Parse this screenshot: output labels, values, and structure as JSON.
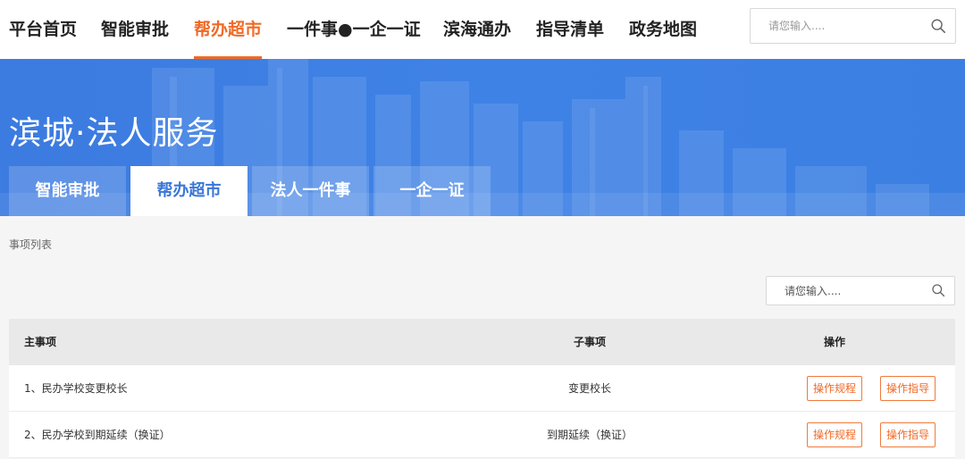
{
  "topnav": {
    "items": [
      {
        "label": "平台首页",
        "active": false
      },
      {
        "label": "智能审批",
        "active": false
      },
      {
        "label": "帮办超市",
        "active": true
      },
      {
        "label": "一件事●一企一证",
        "active": false
      },
      {
        "label": "滨海通办",
        "active": false
      },
      {
        "label": "指导清单",
        "active": false
      },
      {
        "label": "政务地图",
        "active": false
      }
    ],
    "search_placeholder": "请您输入....",
    "accent_color": "#f06a26"
  },
  "banner": {
    "title": "滨城·法人服务",
    "tabs": [
      {
        "label": "智能审批",
        "active": false
      },
      {
        "label": "帮办超市",
        "active": true
      },
      {
        "label": "法人一件事",
        "active": false
      },
      {
        "label": "一企一证",
        "active": false
      }
    ],
    "color": "#3f82e6"
  },
  "content": {
    "breadcrumb": "事项列表",
    "search_placeholder": "请您输入....",
    "table": {
      "headers": [
        "主事项",
        "子事项",
        "操作"
      ],
      "rows": [
        {
          "main": "1、民办学校变更校长",
          "sub": "变更校长",
          "actions": [
            "操作规程",
            "操作指导"
          ]
        },
        {
          "main": "2、民办学校到期延续（换证）",
          "sub": "到期延续（换证）",
          "actions": [
            "操作规程",
            "操作指导"
          ]
        }
      ]
    }
  },
  "icons": {
    "search": "search-icon"
  }
}
